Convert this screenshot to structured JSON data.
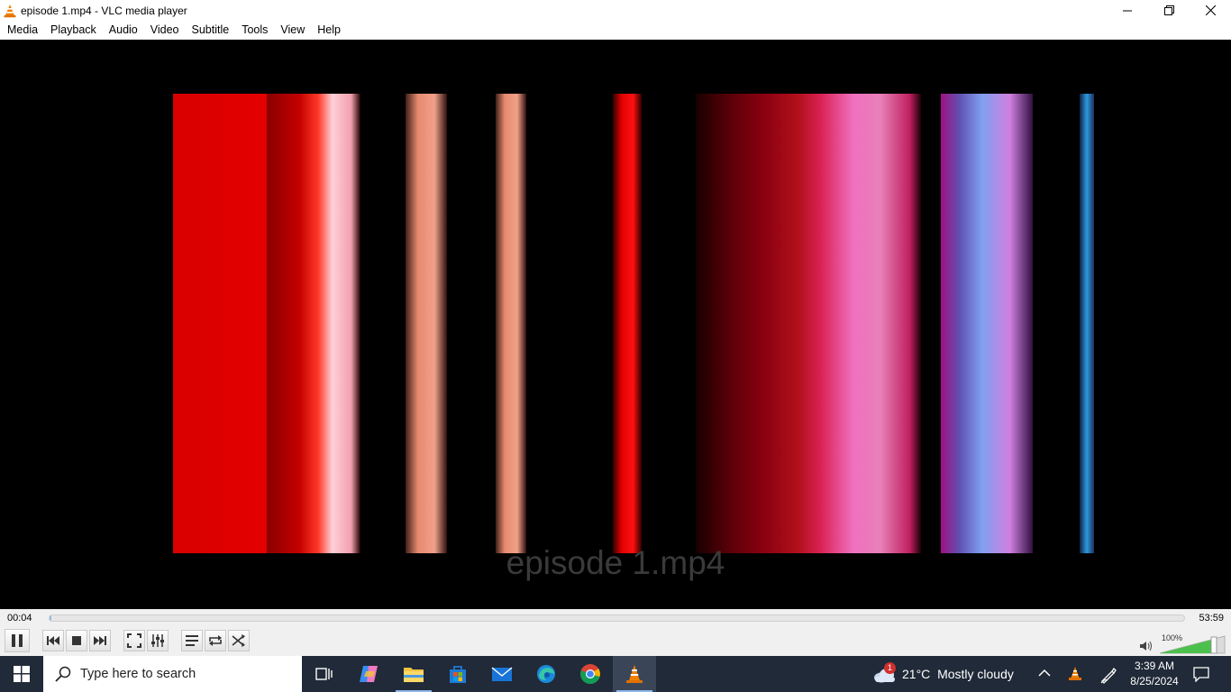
{
  "window": {
    "title": "episode 1.mp4 - VLC media player",
    "icon": "vlc-cone-icon"
  },
  "menu": [
    {
      "label": "Media"
    },
    {
      "label": "Playback"
    },
    {
      "label": "Audio"
    },
    {
      "label": "Video"
    },
    {
      "label": "Subtitle"
    },
    {
      "label": "Tools"
    },
    {
      "label": "View"
    },
    {
      "label": "Help"
    }
  ],
  "video": {
    "caption": "episode 1.mp4",
    "background": "#000000"
  },
  "playback": {
    "current_time": "00:04",
    "total_time": "53:59",
    "progress_fraction": 0.001
  },
  "controls": {
    "buttons": [
      "pause-icon",
      "previous-icon",
      "stop-icon",
      "next-icon",
      "fullscreen-icon",
      "extended-settings-icon",
      "playlist-icon",
      "loop-icon",
      "shuffle-icon"
    ]
  },
  "volume": {
    "label": "100%",
    "level_fraction": 1.0,
    "icon": "speaker-icon"
  },
  "taskbar": {
    "search_placeholder": "Type here to search",
    "weather": {
      "temperature": "21°C",
      "condition": "Mostly cloudy",
      "badge": "1"
    },
    "clock": {
      "time": "3:39 AM",
      "date": "8/25/2024"
    },
    "apps": [
      "task-view-icon",
      "copilot-icon",
      "file-explorer-icon",
      "microsoft-store-icon",
      "mail-icon",
      "edge-icon",
      "chrome-icon",
      "vlc-icon"
    ]
  },
  "colors": {
    "accent": "#ff8800",
    "taskbar": "#202a38",
    "seek_fill": "#9bbbe0",
    "volume_green": "#4cc04c"
  }
}
